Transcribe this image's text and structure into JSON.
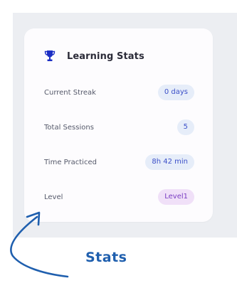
{
  "card": {
    "title": "Learning Stats",
    "icon": "trophy-icon",
    "stats": [
      {
        "label": "Current Streak",
        "value": "0 days"
      },
      {
        "label": "Total Sessions",
        "value": "5"
      },
      {
        "label": "Time Practiced",
        "value": "8h 42 min"
      },
      {
        "label": "Level",
        "value": "Level1"
      }
    ]
  },
  "annotation": {
    "caption": "Stats",
    "icon": "curved-arrow-icon"
  },
  "colors": {
    "trophy": "#1c2fc4",
    "badge_blue_bg": "#e6edf9",
    "badge_blue_text": "#3b4fc8",
    "badge_purple_bg": "#f0e0f8",
    "badge_purple_text": "#7a3ec2",
    "annotation": "#1f5fae"
  }
}
